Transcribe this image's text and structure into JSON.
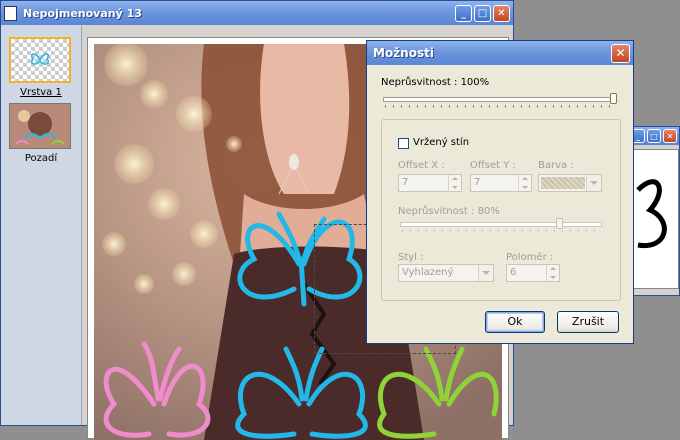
{
  "editor": {
    "title": "Nepojmenovaný 13",
    "layers": [
      {
        "name": "Vrstva 1"
      },
      {
        "name": "Pozadí"
      }
    ]
  },
  "dialog": {
    "title": "Možnosti",
    "opacity_label": "Neprůsvitnost : 100%",
    "opacity_value": 100,
    "shadow_checkbox_label": "Vržený stín",
    "shadow_checked": false,
    "offset_x_label": "Offset X :",
    "offset_x_value": "7",
    "offset_y_label": "Offset Y :",
    "offset_y_value": "7",
    "color_label": "Barva :",
    "shadow_opacity_label": "Neprůsvitnost : 80%",
    "shadow_opacity_value": 80,
    "style_label": "Styl :",
    "style_value": "Vyhlazený",
    "radius_label": "Poloměr :",
    "radius_value": "6",
    "ok_label": "Ok",
    "cancel_label": "Zrušit"
  },
  "colors": {
    "butterfly_cyan": "#22b8e8",
    "butterfly_pink": "#f08ccc",
    "butterfly_green": "#8fd23a",
    "title_blue": "#5a86d4"
  }
}
